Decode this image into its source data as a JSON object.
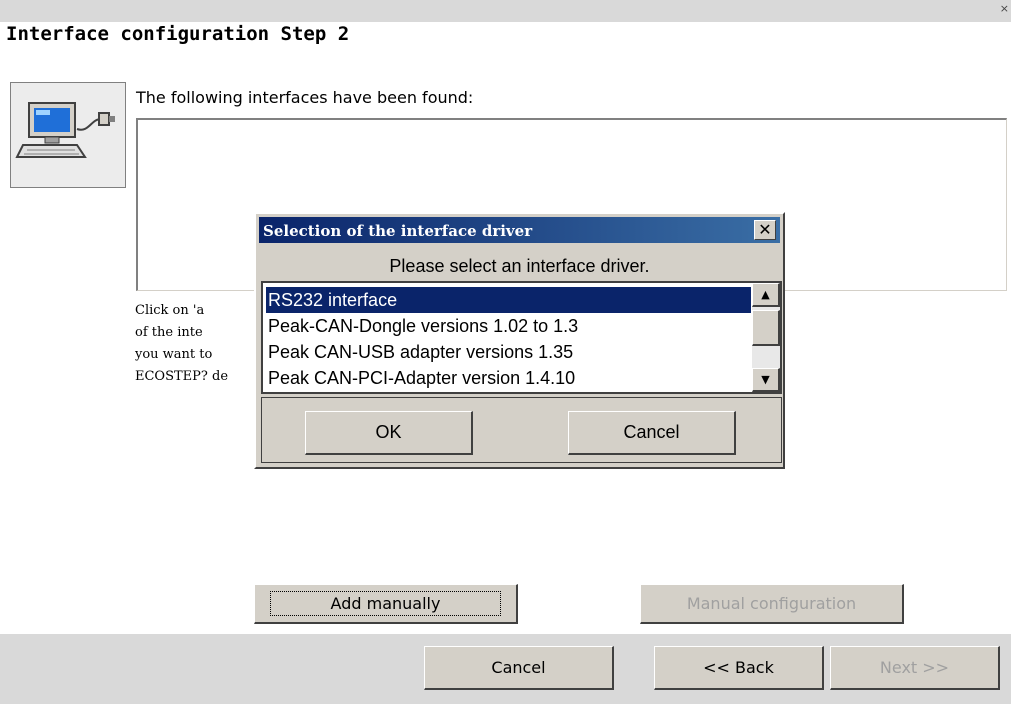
{
  "window": {
    "close_glyph": "×",
    "step_title": "Interface configuration Step 2"
  },
  "main": {
    "found_text": "The following interfaces have been found:",
    "description_lines": [
      "Click on 'a                                                      nual configuration",
      "of the inte                                                      ous interfaces. If",
      "you want to                                                      nt to run the",
      "ECOSTEP? de"
    ],
    "icon": "computer-interface-icon"
  },
  "buttons": {
    "add_manually": "Add manually",
    "manual_configuration": "Manual configuration",
    "cancel": "Cancel",
    "back": "<< Back",
    "next": "Next >>"
  },
  "dialog": {
    "title": "Selection of the interface driver",
    "close_glyph": "✕",
    "prompt": "Please select an interface driver.",
    "drivers": [
      "RS232 interface",
      "Peak-CAN-Dongle versions 1.02 to 1.3",
      "Peak CAN-USB adapter versions 1.35",
      "Peak CAN-PCI-Adapter version 1.4.10"
    ],
    "selected_index": 0,
    "ok_label": "OK",
    "cancel_label": "Cancel"
  },
  "colors": {
    "selection": "#0a246a",
    "dialog_face": "#d4d0c8",
    "bar_gray": "#d9d9d9"
  }
}
